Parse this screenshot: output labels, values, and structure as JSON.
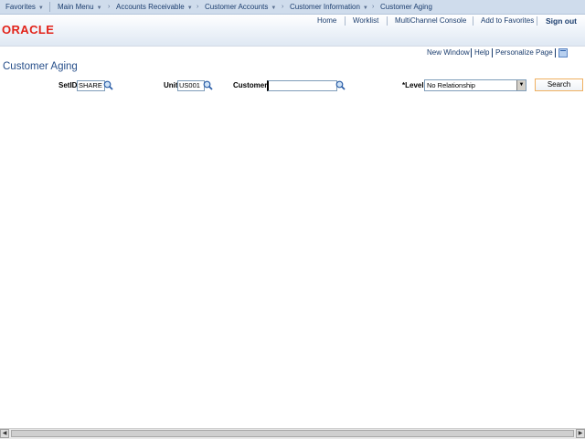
{
  "nav": {
    "favorites": "Favorites",
    "main_menu": "Main Menu",
    "breadcrumbs": [
      "Accounts Receivable",
      "Customer Accounts",
      "Customer Information",
      "Customer Aging"
    ]
  },
  "header": {
    "logo": "ORACLE",
    "links": [
      "Home",
      "Worklist",
      "MultiChannel Console",
      "Add to Favorites"
    ],
    "sign_out": "Sign out"
  },
  "pagelet": {
    "new_window": "New Window",
    "help": "Help",
    "personalize": "Personalize Page"
  },
  "page": {
    "title": "Customer Aging"
  },
  "form": {
    "setid_label": "SetID",
    "setid_value": "SHARE",
    "unit_label": "Unit",
    "unit_value": "US001",
    "customer_label": "Customer",
    "customer_value": "",
    "level_label": "*Level",
    "level_value": "No Relationship",
    "search_label": "Search"
  }
}
